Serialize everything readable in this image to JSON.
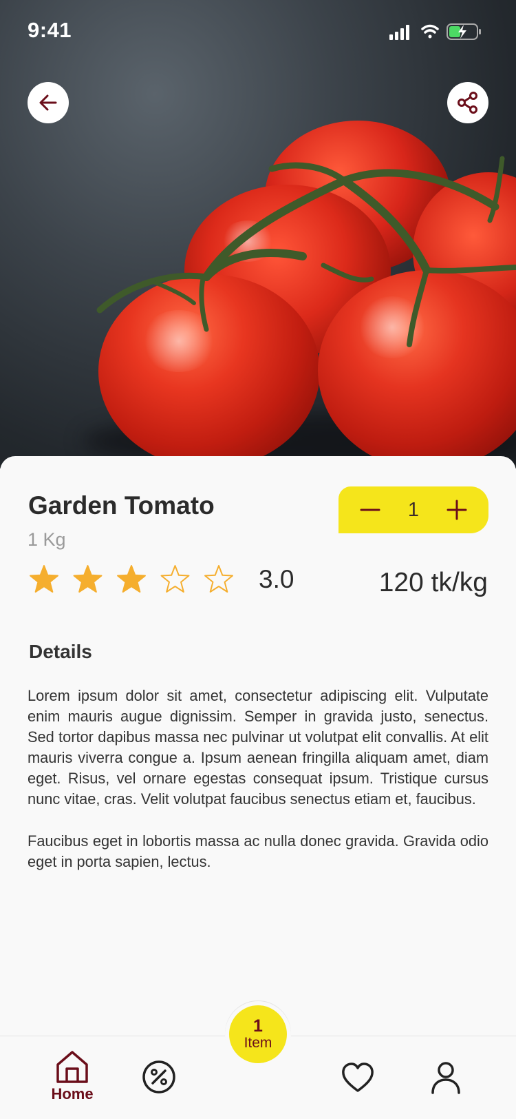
{
  "status_bar": {
    "time": "9:41"
  },
  "header": {
    "back_icon": "arrow-left-icon",
    "share_icon": "share-icon"
  },
  "product": {
    "name": "Garden Tomato",
    "unit": "1 Kg",
    "rating": 3.0,
    "rating_label": "3.0",
    "rating_max": 5,
    "price": "120 tk/kg",
    "quantity": "1"
  },
  "details": {
    "heading": "Details",
    "paragraphs": [
      "Lorem ipsum dolor sit amet, consectetur adipiscing elit. Vulputate enim mauris augue dignissim. Semper in gravida justo, senectus. Sed tortor dapibus massa nec pulvinar ut volutpat elit convallis. At elit mauris viverra congue a. Ipsum aenean fringilla aliquam amet, diam eget. Risus, vel ornare egestas consequat ipsum. Tristique cursus nunc vitae, cras. Velit volutpat faucibus senectus etiam et, faucibus.",
      "Faucibus eget in lobortis massa ac nulla donec gravida. Gravida odio eget in porta sapien, lectus."
    ]
  },
  "cart": {
    "count": "1",
    "label": "Item"
  },
  "nav": {
    "home_label": "Home",
    "items": [
      "home-icon",
      "discount-icon",
      "heart-icon",
      "user-icon"
    ]
  },
  "colors": {
    "accent_yellow": "#f5e51b",
    "brand_maroon": "#6b0e1a",
    "star": "#f5ae2e",
    "text_dark": "#2b2b2b",
    "text_muted": "#9a9a9a"
  }
}
